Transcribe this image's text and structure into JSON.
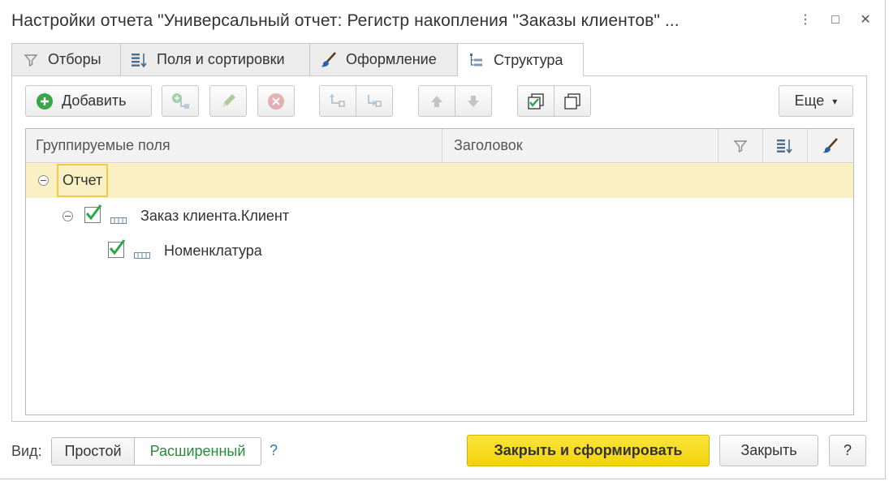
{
  "window": {
    "title": "Настройки отчета \"Универсальный отчет: Регистр накопления \"Заказы клиентов\" ...",
    "more_glyph": "⋮",
    "maximize_glyph": "□",
    "close_glyph": "✕"
  },
  "tabs": [
    {
      "label": "Отборы",
      "icon": "filter-icon"
    },
    {
      "label": "Поля и сортировки",
      "icon": "fields-sort-icon"
    },
    {
      "label": "Оформление",
      "icon": "brush-icon"
    },
    {
      "label": "Структура",
      "icon": "structure-icon",
      "active": true
    }
  ],
  "toolbar": {
    "add_label": "Добавить",
    "more_label": "Еще",
    "more_arrow": "▾"
  },
  "grid": {
    "headers": {
      "grouping_fields": "Группируемые поля",
      "heading": "Заголовок"
    },
    "rows": [
      {
        "label": "Отчет",
        "level": 0,
        "selected": true
      },
      {
        "label": "Заказ клиента.Клиент",
        "level": 1,
        "checked": true
      },
      {
        "label": "Номенклатура",
        "level": 2,
        "checked": true
      }
    ]
  },
  "footer": {
    "view_label": "Вид:",
    "view_simple": "Простой",
    "view_extended": "Расширенный",
    "help_link": "?",
    "close_and_build": "Закрыть и сформировать",
    "close": "Закрыть",
    "help_button": "?"
  },
  "colors": {
    "selected_row": "#fbf0c3",
    "primary_button": "#f2d20c",
    "active_view": "#2a8a3a",
    "check_green": "#2aa84a"
  }
}
